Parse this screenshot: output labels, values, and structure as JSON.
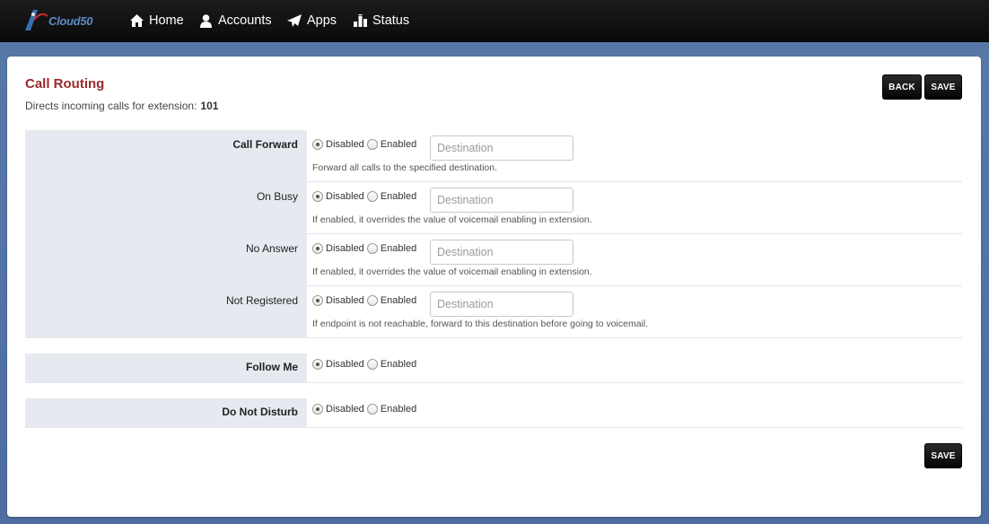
{
  "nav": {
    "logo_text": "Cloud50",
    "items": [
      {
        "label": "Home",
        "icon": "home-icon"
      },
      {
        "label": "Accounts",
        "icon": "user-icon"
      },
      {
        "label": "Apps",
        "icon": "send-icon"
      },
      {
        "label": "Status",
        "icon": "status-icon"
      }
    ]
  },
  "page": {
    "title": "Call Routing",
    "subtitle_prefix": "Directs incoming calls for extension:",
    "extension": "101",
    "back_label": "BACK",
    "save_label": "SAVE"
  },
  "radio": {
    "disabled": "Disabled",
    "enabled": "Enabled"
  },
  "rows": [
    {
      "label": "Call Forward",
      "selected": "Disabled",
      "placeholder": "Destination",
      "help": "Forward all calls to the specified destination."
    },
    {
      "label": "On Busy",
      "selected": "Disabled",
      "placeholder": "Destination",
      "help": "If enabled, it overrides the value of voicemail enabling in extension."
    },
    {
      "label": "No Answer",
      "selected": "Disabled",
      "placeholder": "Destination",
      "help": "If enabled, it overrides the value of voicemail enabling in extension."
    },
    {
      "label": "Not Registered",
      "selected": "Disabled",
      "placeholder": "Destination",
      "help": "If endpoint is not reachable, forward to this destination before going to voicemail."
    },
    {
      "label": "Follow Me",
      "selected": "Disabled"
    },
    {
      "label": "Do Not Disturb",
      "selected": "Disabled"
    }
  ],
  "colors": {
    "title": "#9a2a2a",
    "label_bg": "#e6eaf0",
    "navbar": "#111111",
    "background": "#5879a8"
  }
}
